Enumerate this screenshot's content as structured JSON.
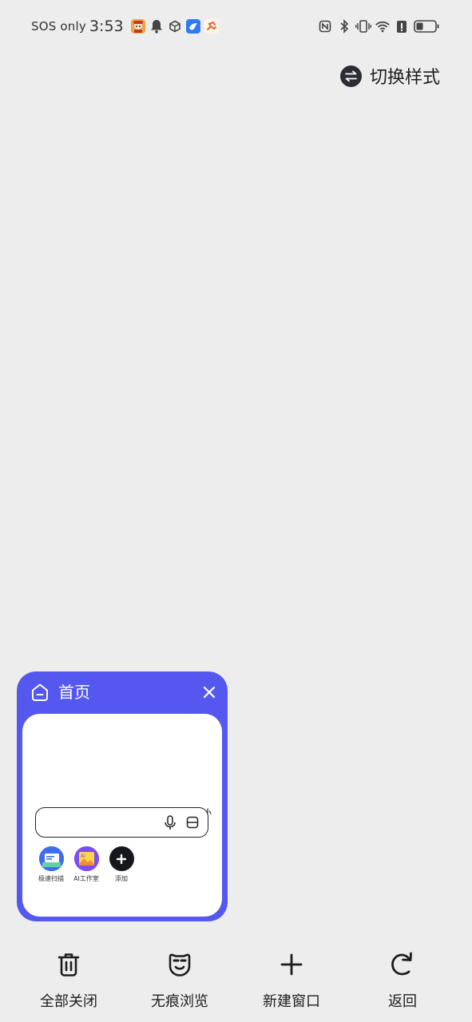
{
  "status_bar": {
    "carrier": "SOS only",
    "time": "3:53",
    "left_icons": [
      "app-avatar-icon",
      "bell-icon",
      "cube-icon",
      "bird-app-icon",
      "runner-app-icon"
    ],
    "right_icons": [
      "nfc-icon",
      "bluetooth-icon",
      "vibrate-icon",
      "wifi-icon",
      "battery-alert-icon",
      "battery-icon"
    ]
  },
  "header": {
    "switch_style_label": "切换样式"
  },
  "tab_card": {
    "title": "首页",
    "accent_color": "#5558ef",
    "shortcuts": [
      {
        "label": "极速扫描",
        "icon": "scan-doc-icon"
      },
      {
        "label": "AI工作室",
        "icon": "ai-studio-icon"
      },
      {
        "label": "添加",
        "icon": "add-icon"
      }
    ]
  },
  "bottom_bar": {
    "close_all": "全部关闭",
    "incognito": "无痕浏览",
    "new_window": "新建窗口",
    "back": "返回"
  }
}
